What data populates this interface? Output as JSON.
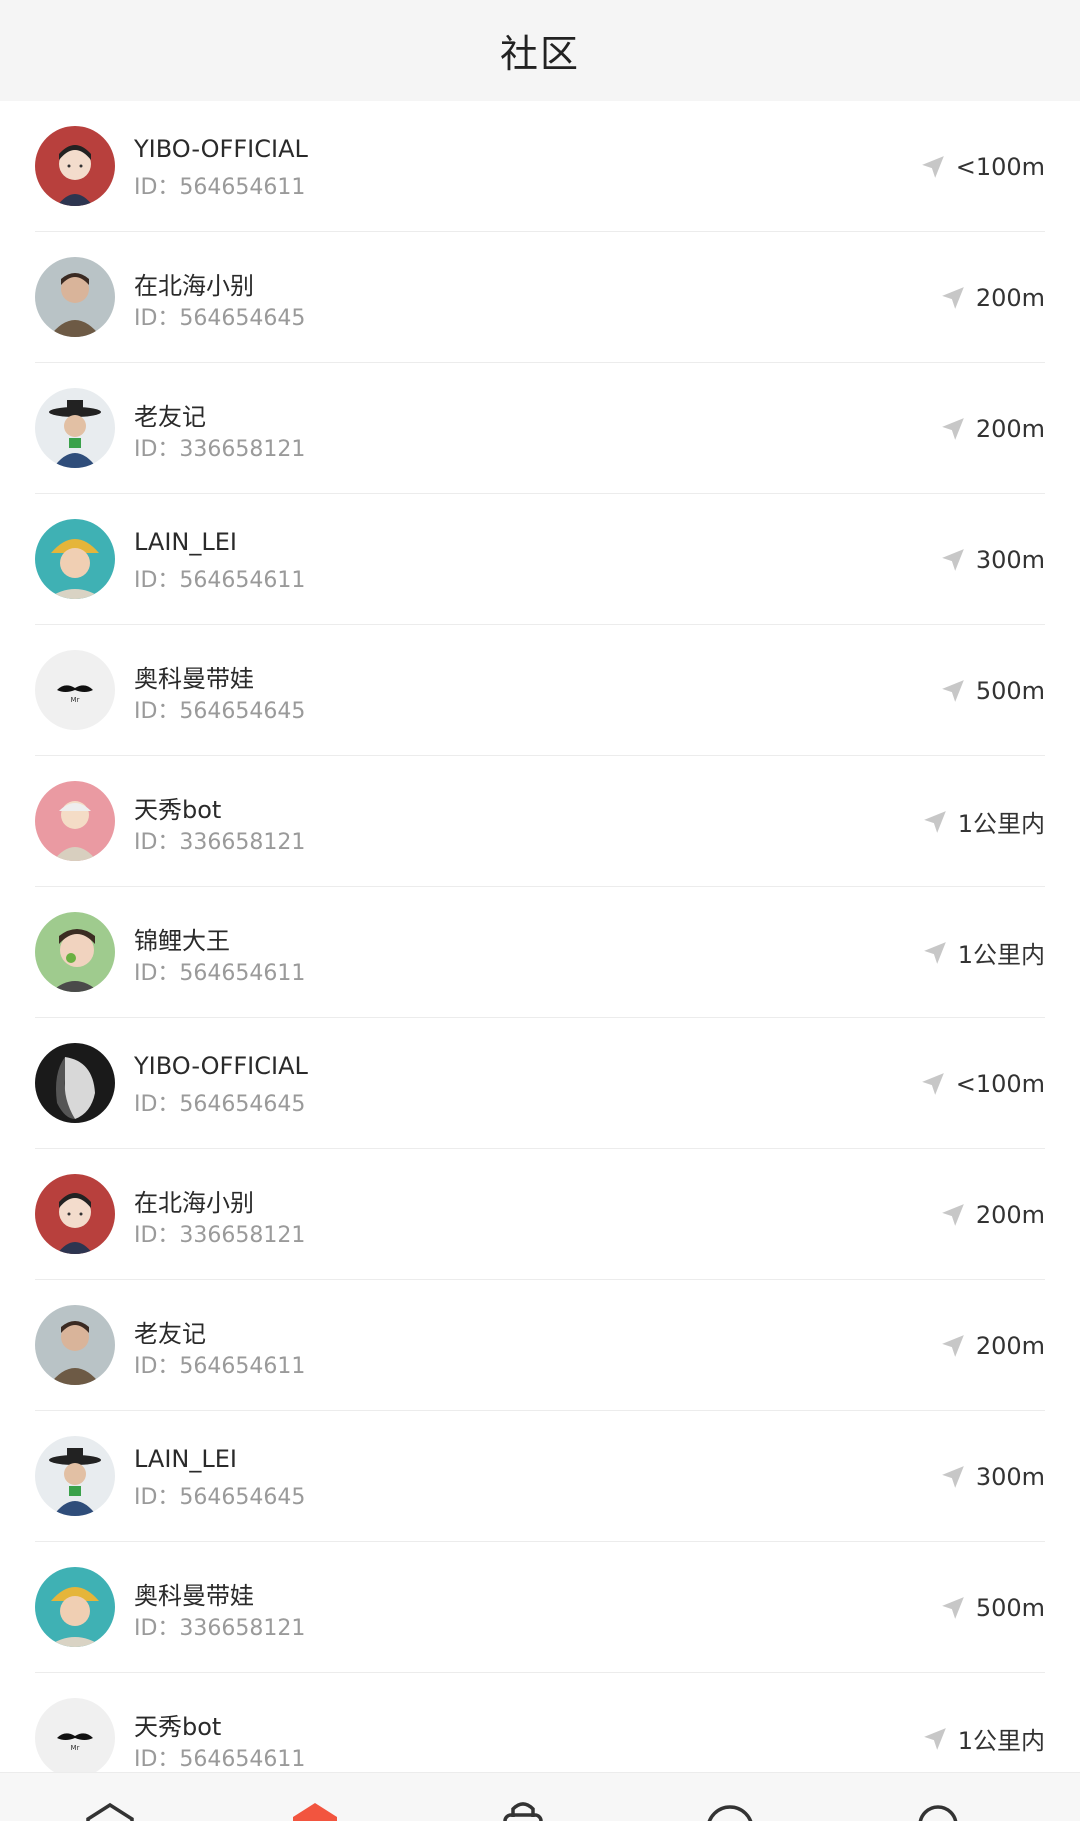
{
  "header": {
    "title": "社区"
  },
  "users": [
    {
      "name": "YIBO-OFFICIAL",
      "id": "ID：564654611",
      "distance": "<100m"
    },
    {
      "name": "在北海小别",
      "id": "ID：564654645",
      "distance": "200m"
    },
    {
      "name": "老友记",
      "id": "ID：336658121",
      "distance": "200m"
    },
    {
      "name": "LAIN_LEI",
      "id": "ID：564654611",
      "distance": "300m"
    },
    {
      "name": "奥科曼带娃",
      "id": "ID：564654645",
      "distance": "500m"
    },
    {
      "name": "天秀bot",
      "id": "ID：336658121",
      "distance": "1公里内"
    },
    {
      "name": "锦鲤大王",
      "id": "ID：564654611",
      "distance": "1公里内"
    },
    {
      "name": "YIBO-OFFICIAL",
      "id": "ID：564654645",
      "distance": "<100m"
    },
    {
      "name": "在北海小别",
      "id": "ID：336658121",
      "distance": "200m"
    },
    {
      "name": "老友记",
      "id": "ID：564654611",
      "distance": "200m"
    },
    {
      "name": "LAIN_LEI",
      "id": "ID：564654645",
      "distance": "300m"
    },
    {
      "name": "奥科曼带娃",
      "id": "ID：336658121",
      "distance": "500m"
    },
    {
      "name": "天秀bot",
      "id": "ID：564654611",
      "distance": "1公里内"
    }
  ],
  "icons": {
    "distance": "location-arrow-icon"
  },
  "tabbar": {
    "items": [
      "home-icon",
      "community-icon",
      "bag-icon",
      "message-icon",
      "profile-icon"
    ],
    "active_index": 1,
    "active_color": "#f2553f"
  }
}
